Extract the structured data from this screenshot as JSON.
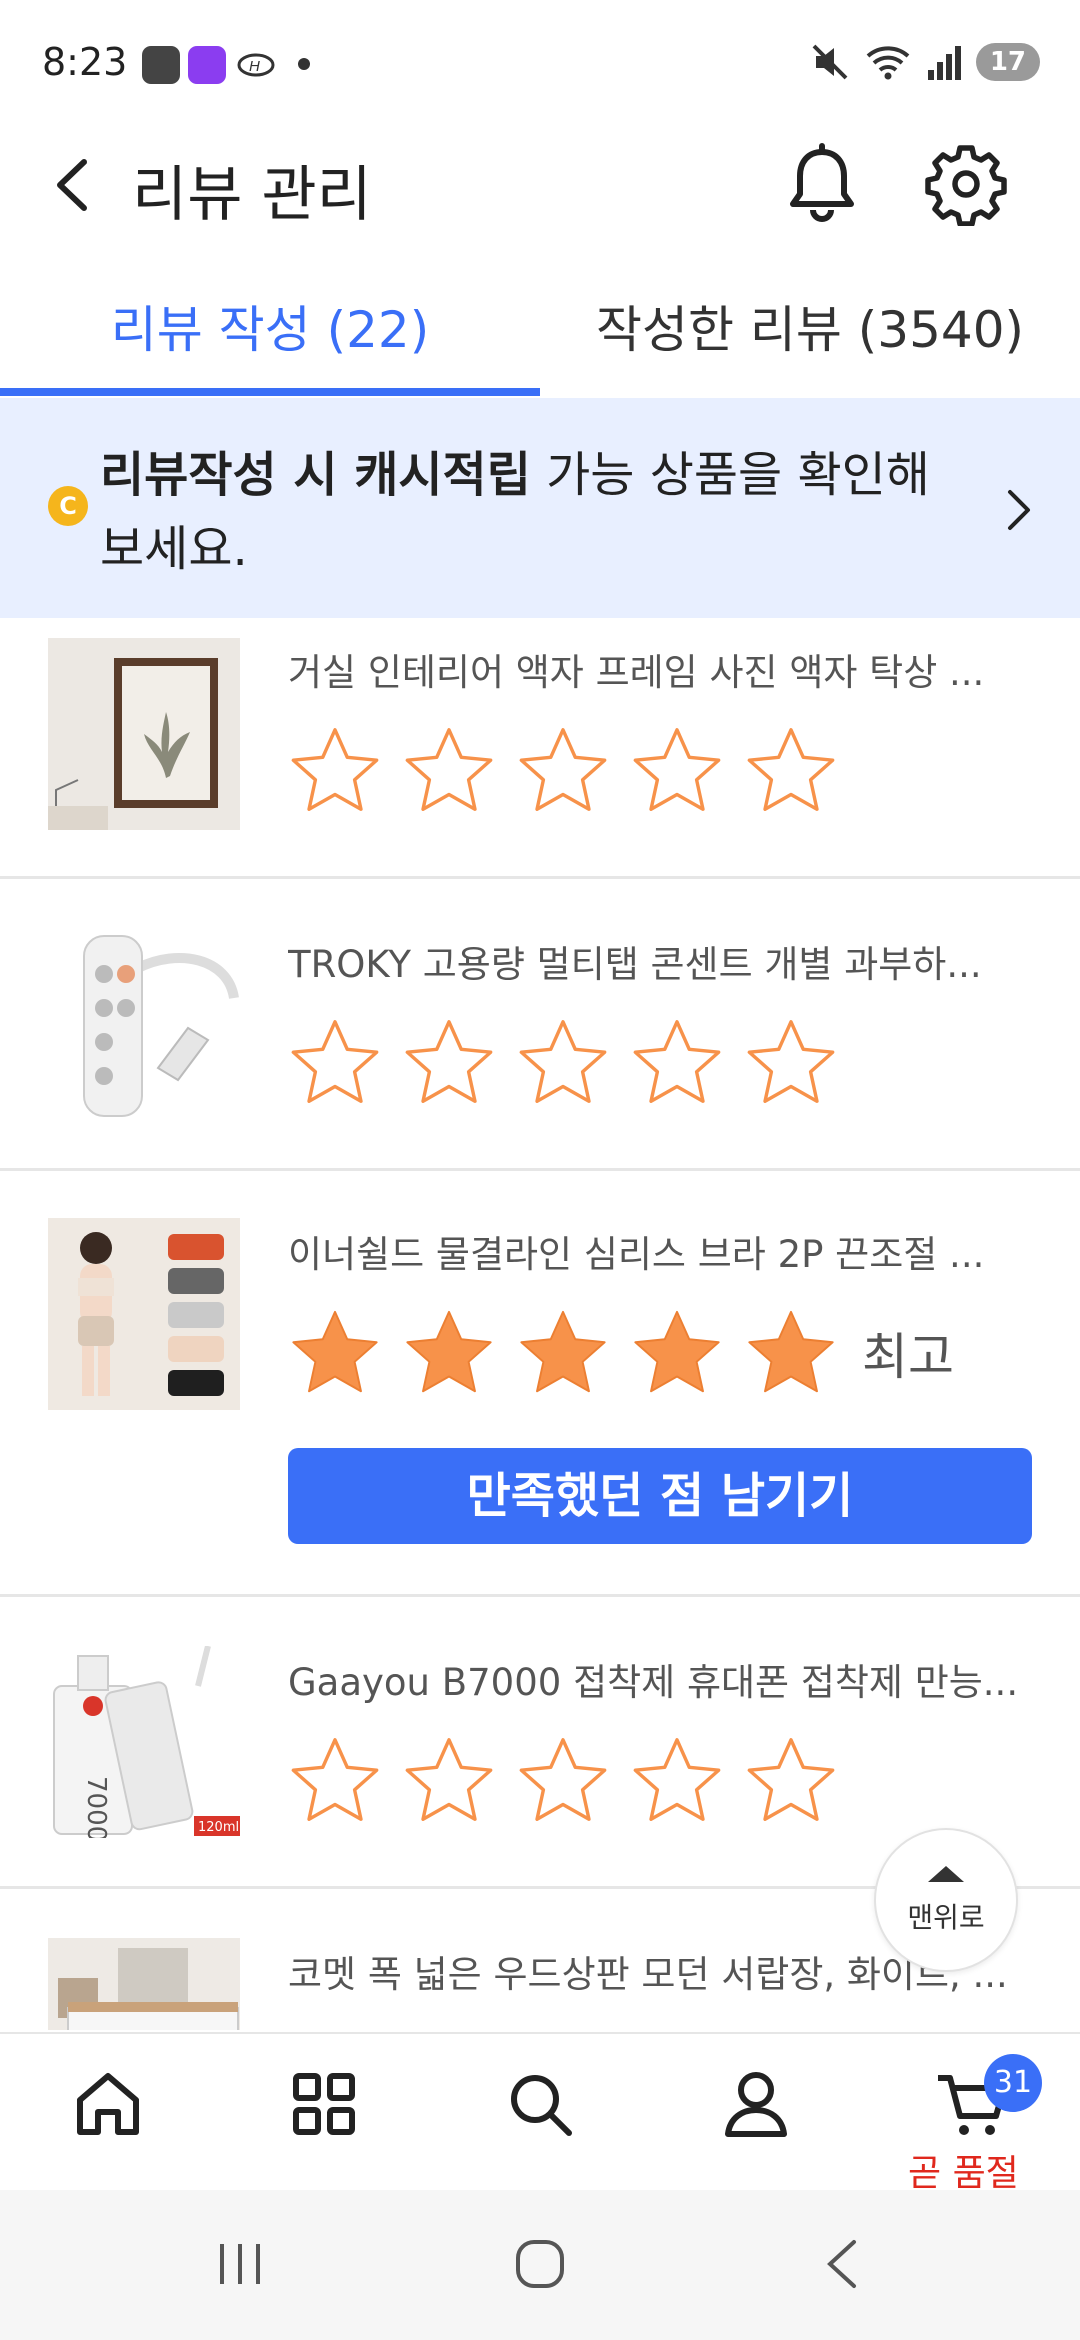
{
  "status_bar": {
    "time": "8:23",
    "battery": "17"
  },
  "header": {
    "title": "리뷰 관리"
  },
  "tabs": [
    {
      "label": "리뷰 작성 (22)",
      "active": true
    },
    {
      "label": "작성한 리뷰 (3540)",
      "active": false
    }
  ],
  "banner": {
    "coin_label": "C",
    "bold_text": "리뷰작성 시 캐시적립",
    "rest_text": " 가능 상품을 확인해보세요."
  },
  "products": [
    {
      "name": "거실 인테리어 액자 프레임 사진 액자 탁상 ...",
      "rating": 0,
      "rating_label": "",
      "button": ""
    },
    {
      "name": "TROKY 고용량 멀티탭 콘센트 개별 과부하...",
      "rating": 0,
      "rating_label": "",
      "button": ""
    },
    {
      "name": "이너쉴드 물결라인 심리스 브라 2P 끈조절 ...",
      "rating": 5,
      "rating_label": "최고",
      "button": "만족했던 점 남기기"
    },
    {
      "name": "Gaayou B7000 접착제 휴대폰 접착제 만능...",
      "rating": 0,
      "rating_label": "",
      "button": ""
    },
    {
      "name": "코멧 폭 넓은 우드상판 모던 서랍장, 화이트, ...",
      "rating": 0,
      "rating_label": "",
      "button": ""
    }
  ],
  "thumb_text": {
    "glue_volume": "120ml",
    "glue_model": "7000"
  },
  "scroll_top": {
    "label": "맨위로"
  },
  "bottom_nav": {
    "cart_count": "31",
    "cart_alert": "곧 품절"
  },
  "colors": {
    "accent": "#3a6ff7",
    "star": "#f7924a",
    "alert": "#e0281d",
    "banner_bg": "#e8efff"
  }
}
